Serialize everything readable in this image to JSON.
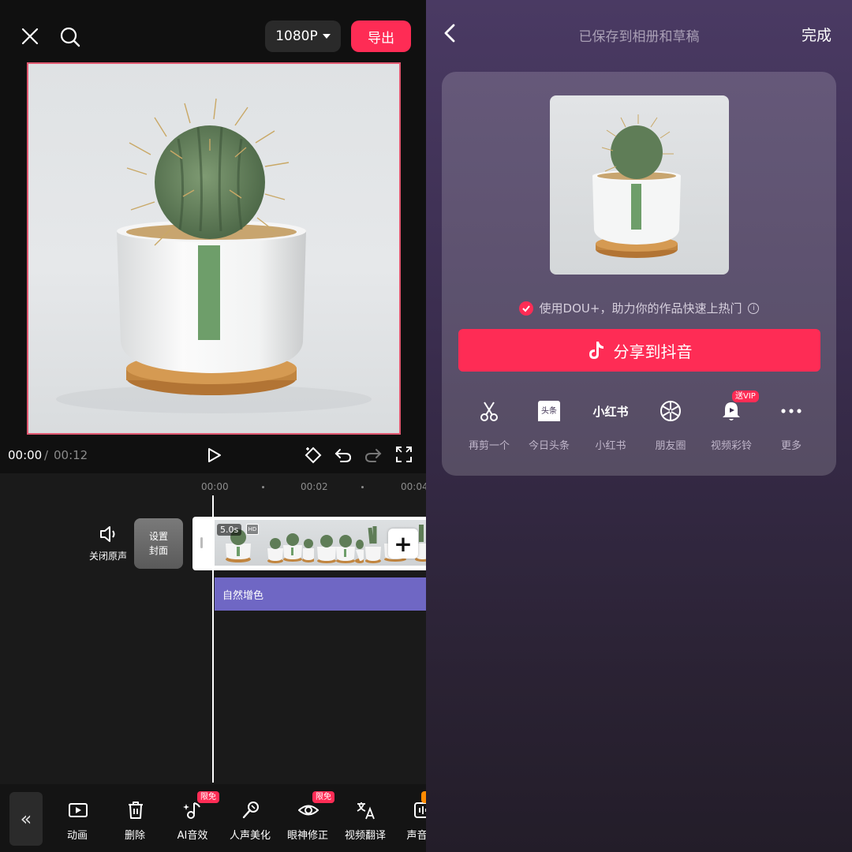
{
  "editor": {
    "resolution": "1080P",
    "export_label": "导出",
    "time_current": "00:00",
    "time_separator": "/",
    "time_total": "00:12",
    "ruler": [
      "00:00",
      "00:02",
      "00:04"
    ],
    "mute_label": "关闭原声",
    "cover_label_1": "设置",
    "cover_label_2": "封面",
    "clip_duration": "5.0s",
    "hd_badge": "HD",
    "add_symbol": "+",
    "filter_label": "自然增色",
    "collapse_symbol": "«",
    "tools": [
      {
        "label": "动画",
        "icon": "animation-icon"
      },
      {
        "label": "删除",
        "icon": "trash-icon"
      },
      {
        "label": "AI音效",
        "icon": "ai-sound-icon",
        "tag": "限免"
      },
      {
        "label": "人声美化",
        "icon": "voice-beautify-icon"
      },
      {
        "label": "眼神修正",
        "icon": "eye-icon",
        "tag": "限免"
      },
      {
        "label": "视频翻译",
        "icon": "translate-icon"
      },
      {
        "label": "声音分",
        "icon": "audio-split-icon"
      }
    ],
    "accent_color": "#fe2c55",
    "filter_color": "#6f67c4"
  },
  "share": {
    "title": "已保存到相册和草稿",
    "done_label": "完成",
    "dou_text": "使用DOU+，助力你的作品快速上热门",
    "info_symbol": "i",
    "share_label": "分享到抖音",
    "options": [
      {
        "label": "再剪一个",
        "icon": "scissors-icon"
      },
      {
        "label": "今日头条",
        "icon": "toutiao-icon",
        "glyph": "头条"
      },
      {
        "label": "小红书",
        "icon": "xiaohongshu-icon",
        "glyph": "小红书"
      },
      {
        "label": "朋友圈",
        "icon": "moments-icon"
      },
      {
        "label": "视频彩铃",
        "icon": "bell-icon",
        "tag": "送VIP"
      },
      {
        "label": "更多",
        "icon": "more-icon"
      }
    ]
  }
}
